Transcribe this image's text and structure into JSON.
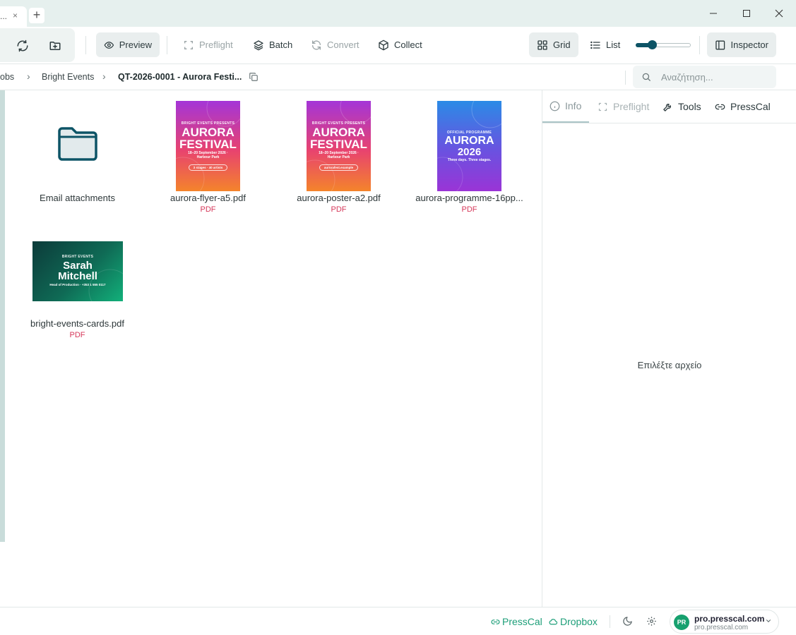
{
  "titlebar": {
    "tab_title": "...",
    "tab_close": "×",
    "new_tab": "+"
  },
  "toolbar": {
    "preview": "Preview",
    "preflight": "Preflight",
    "batch": "Batch",
    "convert": "Convert",
    "collect": "Collect",
    "grid": "Grid",
    "list": "List",
    "inspector": "Inspector",
    "zoom_level": 0.3
  },
  "breadcrumb": {
    "items": [
      "obs",
      "Bright Events",
      "QT-2026-0001 - Aurora Festi..."
    ],
    "separator": "›"
  },
  "search": {
    "placeholder": "Αναζήτηση..."
  },
  "files": [
    {
      "name": "Email attachments",
      "type": ""
    },
    {
      "name": "aurora-flyer-a5.pdf",
      "type": "PDF"
    },
    {
      "name": "aurora-poster-a2.pdf",
      "type": "PDF"
    },
    {
      "name": "aurora-programme-16pp...",
      "type": "PDF"
    },
    {
      "name": "bright-events-cards.pdf",
      "type": "PDF"
    }
  ],
  "thumbs": {
    "flyer": {
      "kicker": "BRIGHT EVENTS PRESENTS",
      "title1": "AURORA",
      "title2": "FESTIVAL",
      "sub": "18–20 September 2026 · Harbour Park",
      "pill": "3 stages · 40 artists"
    },
    "poster": {
      "kicker": "BRIGHT EVENTS PRESENTS",
      "title1": "AURORA",
      "title2": "FESTIVAL",
      "sub": "18–20 September 2026 · Harbour Park",
      "pill": "aurorafest.example"
    },
    "programme": {
      "kicker": "OFFICIAL PROGRAMME",
      "title1": "AURORA",
      "title2": "2026",
      "sub": "Three days. Three stages."
    },
    "cards": {
      "kicker": "BRIGHT EVENTS",
      "title1": "Sarah",
      "title2": "Mitchell",
      "sub": "Head of Production · +353 1 555 0117"
    }
  },
  "inspector": {
    "tabs": [
      "Info",
      "Preflight",
      "Tools",
      "PressCal"
    ],
    "empty_message": "Επιλέξτε αρχείο"
  },
  "status": {
    "presscal": "PressCal",
    "dropbox": "Dropbox",
    "account_name": "pro.presscal.com",
    "account_host": "pro.presscal.com",
    "avatar_initials": "PR"
  },
  "colors": {
    "accent": "#0d5466",
    "link_green": "#1c9e78",
    "pdf_red": "#d6385a"
  }
}
